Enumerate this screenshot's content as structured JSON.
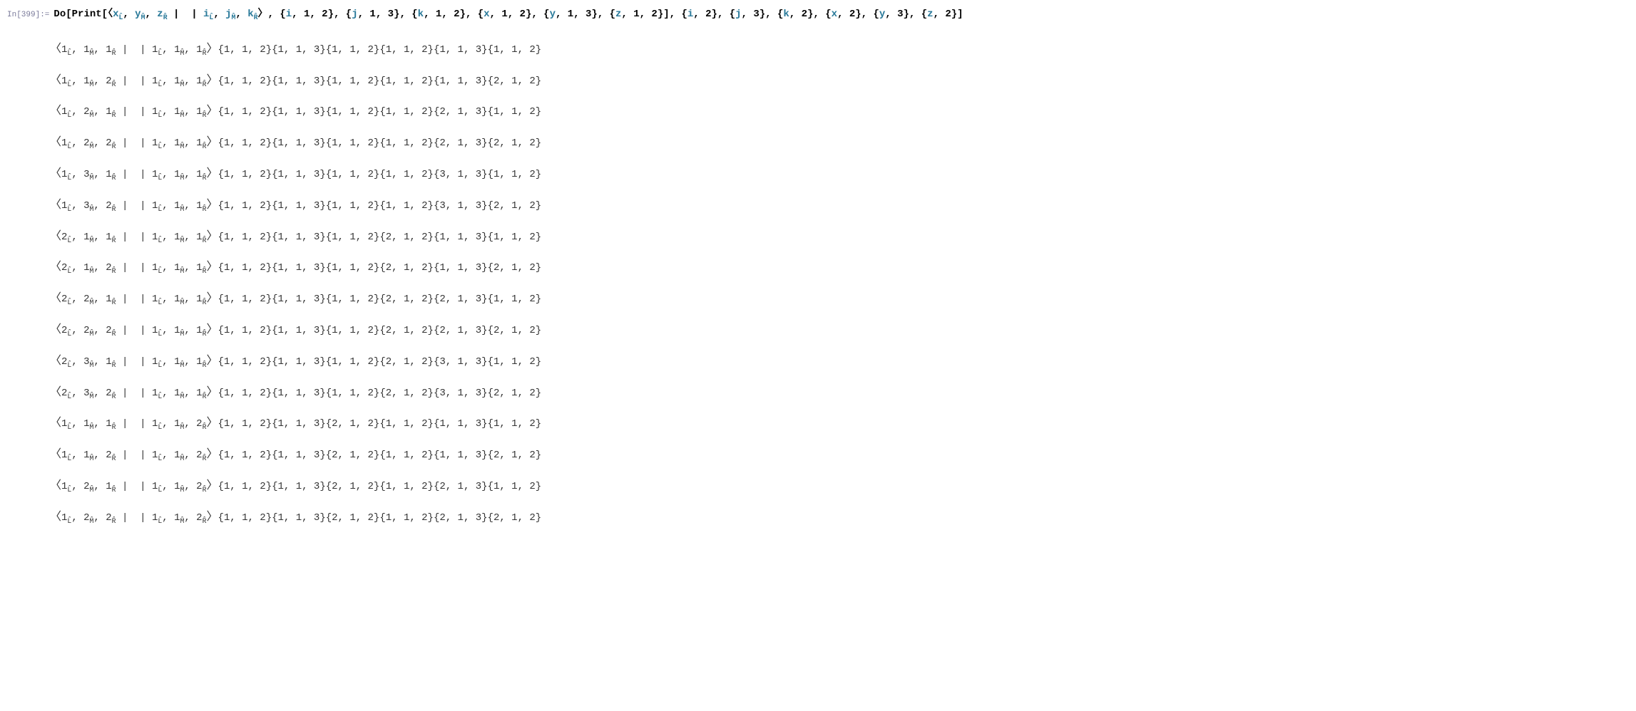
{
  "input": {
    "label": "In[399]:=",
    "command": "Do",
    "print": "Print",
    "bra_vars": [
      {
        "name": "x",
        "sub": "L̂"
      },
      {
        "name": "y",
        "sub": "M̂"
      },
      {
        "name": "z",
        "sub": "R̂"
      }
    ],
    "ket_vars": [
      {
        "name": "i",
        "sub": "L̂"
      },
      {
        "name": "j",
        "sub": "M̂"
      },
      {
        "name": "k",
        "sub": "R̂"
      }
    ],
    "print_ranges": [
      "{i, 1, 2}",
      "{j, 1, 3}",
      "{k, 1, 2}",
      "{x, 1, 2}",
      "{y, 1, 3}",
      "{z, 1, 2}"
    ],
    "do_ranges": [
      "{i, 2}",
      "{j, 3}",
      "{k, 2}",
      "{x, 2}",
      "{y, 3}",
      "{z, 2}"
    ]
  },
  "output_rows": [
    {
      "bra": [
        "1",
        "1",
        "1"
      ],
      "ket": [
        "1",
        "1",
        "1"
      ],
      "lists": [
        "{1, 1, 2}",
        "{1, 1, 3}",
        "{1, 1, 2}",
        "{1, 1, 2}",
        "{1, 1, 3}",
        "{1, 1, 2}"
      ]
    },
    {
      "bra": [
        "1",
        "1",
        "2"
      ],
      "ket": [
        "1",
        "1",
        "1"
      ],
      "lists": [
        "{1, 1, 2}",
        "{1, 1, 3}",
        "{1, 1, 2}",
        "{1, 1, 2}",
        "{1, 1, 3}",
        "{2, 1, 2}"
      ]
    },
    {
      "bra": [
        "1",
        "2",
        "1"
      ],
      "ket": [
        "1",
        "1",
        "1"
      ],
      "lists": [
        "{1, 1, 2}",
        "{1, 1, 3}",
        "{1, 1, 2}",
        "{1, 1, 2}",
        "{2, 1, 3}",
        "{1, 1, 2}"
      ]
    },
    {
      "bra": [
        "1",
        "2",
        "2"
      ],
      "ket": [
        "1",
        "1",
        "1"
      ],
      "lists": [
        "{1, 1, 2}",
        "{1, 1, 3}",
        "{1, 1, 2}",
        "{1, 1, 2}",
        "{2, 1, 3}",
        "{2, 1, 2}"
      ]
    },
    {
      "bra": [
        "1",
        "3",
        "1"
      ],
      "ket": [
        "1",
        "1",
        "1"
      ],
      "lists": [
        "{1, 1, 2}",
        "{1, 1, 3}",
        "{1, 1, 2}",
        "{1, 1, 2}",
        "{3, 1, 3}",
        "{1, 1, 2}"
      ]
    },
    {
      "bra": [
        "1",
        "3",
        "2"
      ],
      "ket": [
        "1",
        "1",
        "1"
      ],
      "lists": [
        "{1, 1, 2}",
        "{1, 1, 3}",
        "{1, 1, 2}",
        "{1, 1, 2}",
        "{3, 1, 3}",
        "{2, 1, 2}"
      ]
    },
    {
      "bra": [
        "2",
        "1",
        "1"
      ],
      "ket": [
        "1",
        "1",
        "1"
      ],
      "lists": [
        "{1, 1, 2}",
        "{1, 1, 3}",
        "{1, 1, 2}",
        "{2, 1, 2}",
        "{1, 1, 3}",
        "{1, 1, 2}"
      ]
    },
    {
      "bra": [
        "2",
        "1",
        "2"
      ],
      "ket": [
        "1",
        "1",
        "1"
      ],
      "lists": [
        "{1, 1, 2}",
        "{1, 1, 3}",
        "{1, 1, 2}",
        "{2, 1, 2}",
        "{1, 1, 3}",
        "{2, 1, 2}"
      ]
    },
    {
      "bra": [
        "2",
        "2",
        "1"
      ],
      "ket": [
        "1",
        "1",
        "1"
      ],
      "lists": [
        "{1, 1, 2}",
        "{1, 1, 3}",
        "{1, 1, 2}",
        "{2, 1, 2}",
        "{2, 1, 3}",
        "{1, 1, 2}"
      ]
    },
    {
      "bra": [
        "2",
        "2",
        "2"
      ],
      "ket": [
        "1",
        "1",
        "1"
      ],
      "lists": [
        "{1, 1, 2}",
        "{1, 1, 3}",
        "{1, 1, 2}",
        "{2, 1, 2}",
        "{2, 1, 3}",
        "{2, 1, 2}"
      ]
    },
    {
      "bra": [
        "2",
        "3",
        "1"
      ],
      "ket": [
        "1",
        "1",
        "1"
      ],
      "lists": [
        "{1, 1, 2}",
        "{1, 1, 3}",
        "{1, 1, 2}",
        "{2, 1, 2}",
        "{3, 1, 3}",
        "{1, 1, 2}"
      ]
    },
    {
      "bra": [
        "2",
        "3",
        "2"
      ],
      "ket": [
        "1",
        "1",
        "1"
      ],
      "lists": [
        "{1, 1, 2}",
        "{1, 1, 3}",
        "{1, 1, 2}",
        "{2, 1, 2}",
        "{3, 1, 3}",
        "{2, 1, 2}"
      ]
    },
    {
      "bra": [
        "1",
        "1",
        "1"
      ],
      "ket": [
        "1",
        "1",
        "2"
      ],
      "lists": [
        "{1, 1, 2}",
        "{1, 1, 3}",
        "{2, 1, 2}",
        "{1, 1, 2}",
        "{1, 1, 3}",
        "{1, 1, 2}"
      ]
    },
    {
      "bra": [
        "1",
        "1",
        "2"
      ],
      "ket": [
        "1",
        "1",
        "2"
      ],
      "lists": [
        "{1, 1, 2}",
        "{1, 1, 3}",
        "{2, 1, 2}",
        "{1, 1, 2}",
        "{1, 1, 3}",
        "{2, 1, 2}"
      ]
    },
    {
      "bra": [
        "1",
        "2",
        "1"
      ],
      "ket": [
        "1",
        "1",
        "2"
      ],
      "lists": [
        "{1, 1, 2}",
        "{1, 1, 3}",
        "{2, 1, 2}",
        "{1, 1, 2}",
        "{2, 1, 3}",
        "{1, 1, 2}"
      ]
    },
    {
      "bra": [
        "1",
        "2",
        "2"
      ],
      "ket": [
        "1",
        "1",
        "2"
      ],
      "lists": [
        "{1, 1, 2}",
        "{1, 1, 3}",
        "{2, 1, 2}",
        "{1, 1, 2}",
        "{2, 1, 3}",
        "{2, 1, 2}"
      ]
    }
  ],
  "subs": [
    "L̂",
    "M̂",
    "R̂"
  ]
}
